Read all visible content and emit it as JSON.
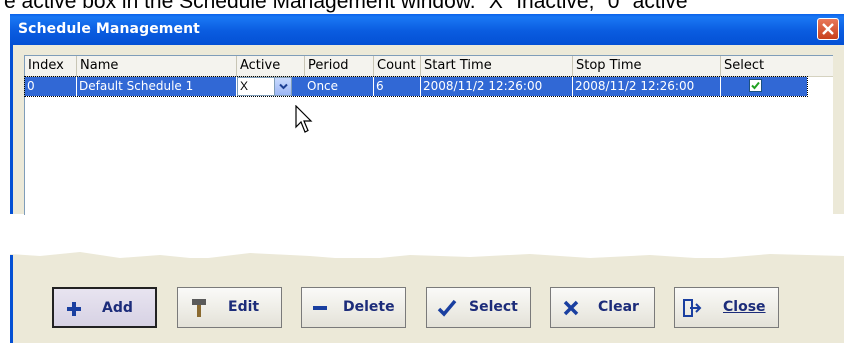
{
  "caption": {
    "text": "e active box in the Schedule Management window. \"X\" Inactive; \"0\" active"
  },
  "window": {
    "title": "Schedule Management"
  },
  "list": {
    "headers": [
      "Index",
      "Name",
      "Active",
      "Period",
      "Count",
      "Start Time",
      "Stop Time",
      "Select"
    ],
    "rows": [
      {
        "index": "0",
        "name": "Default Schedule 1",
        "active": "X",
        "period": "Once",
        "count": "6",
        "start": "2008/11/2 12:26:00",
        "stop": "2008/11/2 12:26:00",
        "selected": true
      }
    ]
  },
  "buttons": {
    "add": "Add",
    "edit": "Edit",
    "delete": "Delete",
    "select": "Select",
    "clear": "Clear",
    "close": "Close"
  },
  "icons": {
    "close": "close-x-icon",
    "dropdown": "chevron-down-icon",
    "add": "plus-icon",
    "edit": "hammer-icon",
    "delete": "minus-icon",
    "select": "checkmark-icon",
    "clear": "x-icon",
    "close_button": "exit-door-icon"
  },
  "colors": {
    "title_bar": "#0a5ce0",
    "selected_row": "#3168d5",
    "button_text": "#1c2c7a",
    "window_bg": "#ece9d8"
  }
}
